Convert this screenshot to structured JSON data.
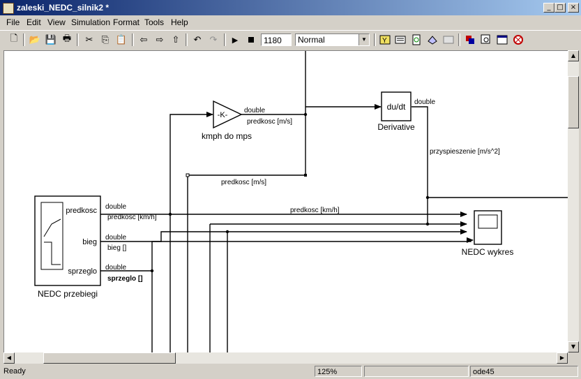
{
  "window": {
    "title": "zaleski_NEDC_silnik2 *"
  },
  "menu": [
    "File",
    "Edit",
    "View",
    "Simulation",
    "Format",
    "Tools",
    "Help"
  ],
  "toolbar": {
    "stop_time": "1180",
    "sim_mode": "Normal"
  },
  "blocks": {
    "nedc_przebiegi": {
      "name": "NEDC przebiegi",
      "ports": [
        "predkosc",
        "bieg",
        "sprzeglo"
      ]
    },
    "gain": {
      "name": "kmph do mps",
      "symbol": "-K-"
    },
    "derivative": {
      "name": "Derivative",
      "symbol": "du/dt"
    },
    "scope": {
      "name": "NEDC wykres"
    }
  },
  "signals": {
    "double": "double",
    "predkosc_kmh": "predkosc [km/h]",
    "bieg": "bieg []",
    "sprzeglo": "sprzeglo []",
    "predkosc_ms": "predkosc [m/s]",
    "predkosc_ms_2": "predkosc [m/s]",
    "predkosc_kmh_2": "predkosc [km/h]",
    "przyspieszenie": "przyspieszenie [m/s^2]"
  },
  "status": {
    "state": "Ready",
    "zoom": "125%",
    "solver": "ode45"
  }
}
